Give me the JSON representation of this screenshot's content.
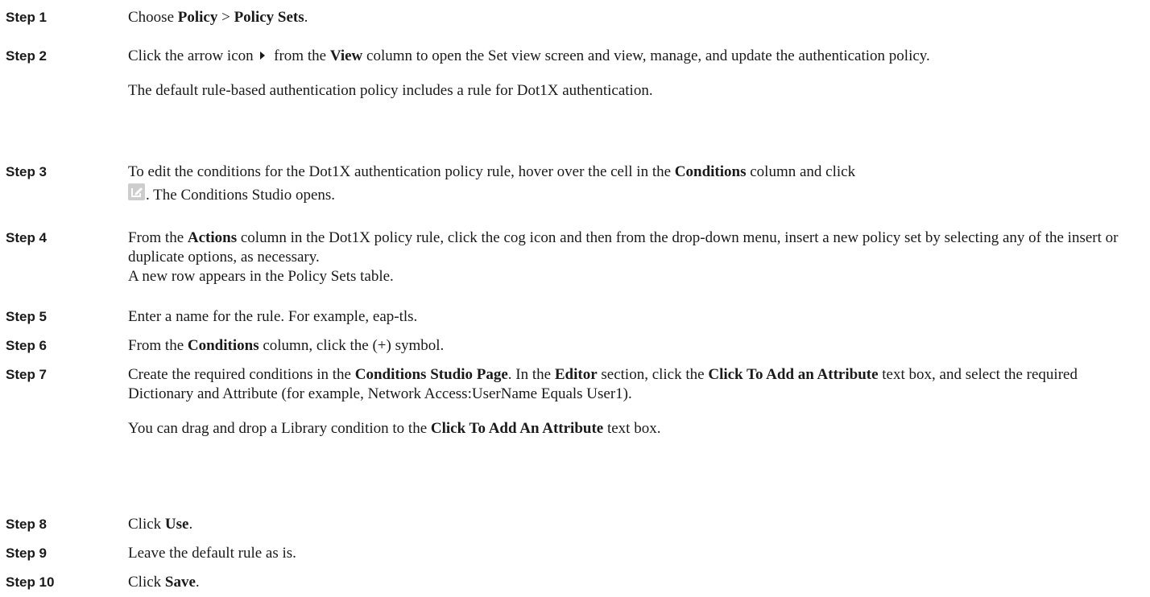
{
  "steps": [
    {
      "label": "Step 1",
      "text": {
        "t1": "Choose ",
        "b1": "Policy",
        "t2": " > ",
        "b2": "Policy Sets",
        "t3": "."
      }
    },
    {
      "label": "Step 2",
      "text": {
        "t1": "Click the arrow icon ",
        "t2": " from the ",
        "b1": "View",
        "t3": " column to open the Set view screen and view, manage, and update the authentication policy."
      },
      "note": "The default rule-based authentication policy includes a rule for Dot1X authentication."
    },
    {
      "label": "Step 3",
      "text": {
        "t1": "To edit the conditions for the Dot1X authentication policy rule, hover over the cell in the ",
        "b1": "Conditions",
        "t2": " column and click",
        "t3": ". The Conditions Studio opens."
      }
    },
    {
      "label": "Step 4",
      "text": {
        "t1": "From the ",
        "b1": "Actions",
        "t2": " column in the Dot1X policy rule, click the cog icon and then from the drop-down menu, insert a new policy set by selecting any of the insert or duplicate options, as necessary."
      },
      "note": "A new row appears in the Policy Sets table."
    },
    {
      "label": "Step 5",
      "text": {
        "t1": "Enter a name for the rule. For example, eap-tls."
      }
    },
    {
      "label": "Step 6",
      "text": {
        "t1": "From the ",
        "b1": "Conditions",
        "t2": " column, click the (+) symbol."
      }
    },
    {
      "label": "Step 7",
      "text": {
        "t1": "Create the required conditions in the ",
        "b1": "Conditions Studio Page",
        "t2": ". In the ",
        "b2": "Editor",
        "t3": " section, click the ",
        "b3": "Click To Add an Attribute",
        "t4": " text box, and select the required Dictionary and Attribute (for example, Network Access:UserName Equals User1)."
      },
      "note": {
        "t1": "You can drag and drop a Library condition to the ",
        "b1": "Click To Add An Attribute",
        "t2": " text box."
      }
    },
    {
      "label": "Step 8",
      "text": {
        "t1": "Click ",
        "b1": "Use",
        "t2": "."
      }
    },
    {
      "label": "Step 9",
      "text": {
        "t1": "Leave the default rule as is."
      }
    },
    {
      "label": "Step 10",
      "text": {
        "t1": "Click ",
        "b1": "Save",
        "t2": "."
      }
    }
  ],
  "icons": {
    "arrow": "chevron-right-icon",
    "edit": "edit-icon",
    "edit_color": "#cdcdcd",
    "arrow_color": "#1a1a1a"
  }
}
